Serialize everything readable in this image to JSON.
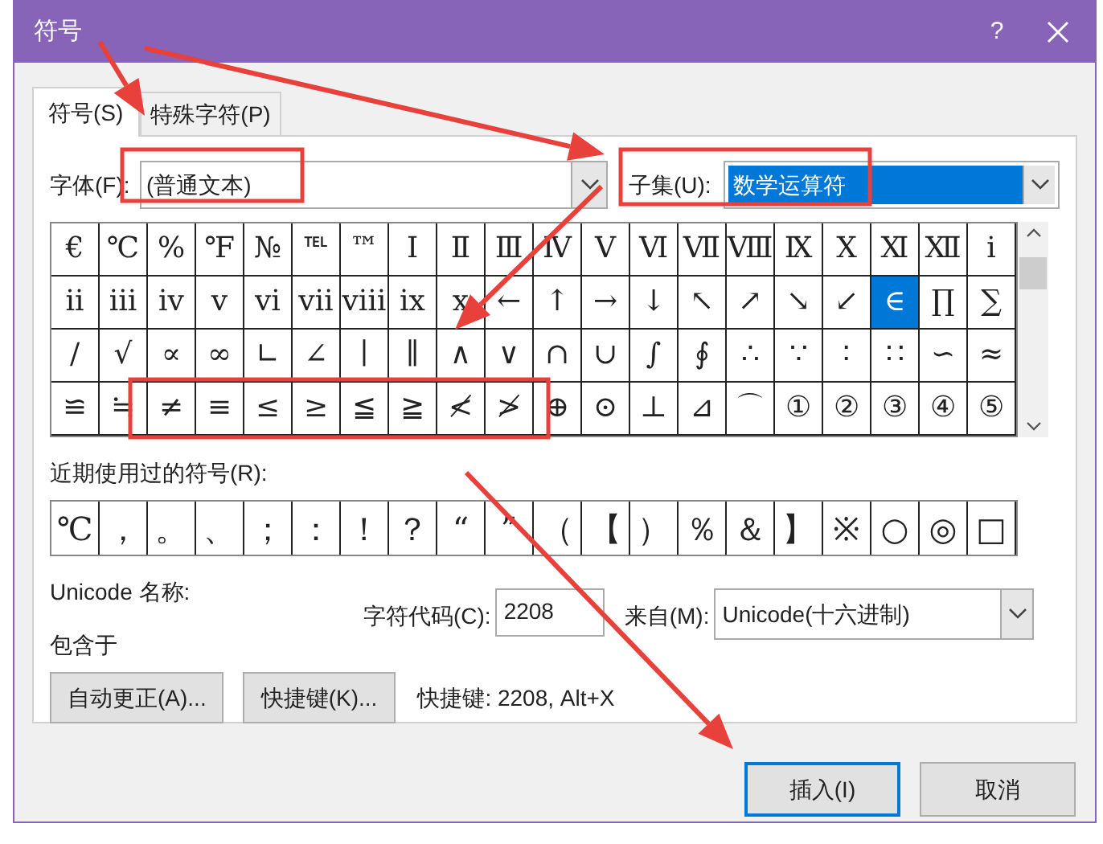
{
  "window": {
    "title": "符号",
    "help": "?"
  },
  "tabs": [
    {
      "label": "符号(S)",
      "selected": true
    },
    {
      "label": "特殊字符(P)",
      "selected": false
    }
  ],
  "font": {
    "label": "字体(F):",
    "value": "(普通文本)"
  },
  "subset": {
    "label": "子集(U):",
    "value": "数学运算符"
  },
  "symbols": [
    [
      {
        "char": "€",
        "selected": false
      },
      {
        "char": "℃",
        "selected": false
      },
      {
        "char": "%",
        "selected": false
      },
      {
        "char": "℉",
        "selected": false
      },
      {
        "char": "№",
        "selected": false
      },
      {
        "char": "℡",
        "selected": false
      },
      {
        "char": "™",
        "selected": false
      },
      {
        "char": "Ⅰ",
        "selected": false
      },
      {
        "char": "Ⅱ",
        "selected": false
      },
      {
        "char": "Ⅲ",
        "selected": false
      },
      {
        "char": "Ⅳ",
        "selected": false
      },
      {
        "char": "Ⅴ",
        "selected": false
      },
      {
        "char": "Ⅵ",
        "selected": false
      },
      {
        "char": "Ⅶ",
        "selected": false
      },
      {
        "char": "Ⅷ",
        "selected": false
      },
      {
        "char": "Ⅸ",
        "selected": false
      },
      {
        "char": "Ⅹ",
        "selected": false
      },
      {
        "char": "Ⅺ",
        "selected": false
      },
      {
        "char": "Ⅻ",
        "selected": false
      },
      {
        "char": "ⅰ",
        "selected": false
      }
    ],
    [
      {
        "char": "ⅱ",
        "selected": false
      },
      {
        "char": "ⅲ",
        "selected": false
      },
      {
        "char": "ⅳ",
        "selected": false
      },
      {
        "char": "ⅴ",
        "selected": false
      },
      {
        "char": "ⅵ",
        "selected": false
      },
      {
        "char": "ⅶ",
        "selected": false
      },
      {
        "char": "ⅷ",
        "selected": false
      },
      {
        "char": "ⅸ",
        "selected": false
      },
      {
        "char": "ⅹ",
        "selected": false
      },
      {
        "char": "←",
        "selected": false
      },
      {
        "char": "↑",
        "selected": false
      },
      {
        "char": "→",
        "selected": false
      },
      {
        "char": "↓",
        "selected": false
      },
      {
        "char": "↖",
        "selected": false
      },
      {
        "char": "↗",
        "selected": false
      },
      {
        "char": "↘",
        "selected": false
      },
      {
        "char": "↙",
        "selected": false
      },
      {
        "char": "∈",
        "selected": true
      },
      {
        "char": "∏",
        "selected": false
      },
      {
        "char": "∑",
        "selected": false
      }
    ],
    [
      {
        "char": "∕",
        "selected": false
      },
      {
        "char": "√",
        "selected": false
      },
      {
        "char": "∝",
        "selected": false
      },
      {
        "char": "∞",
        "selected": false
      },
      {
        "char": "∟",
        "selected": false
      },
      {
        "char": "∠",
        "selected": false
      },
      {
        "char": "∣",
        "selected": false
      },
      {
        "char": "∥",
        "selected": false
      },
      {
        "char": "∧",
        "selected": false
      },
      {
        "char": "∨",
        "selected": false
      },
      {
        "char": "∩",
        "selected": false
      },
      {
        "char": "∪",
        "selected": false
      },
      {
        "char": "∫",
        "selected": false
      },
      {
        "char": "∮",
        "selected": false
      },
      {
        "char": "∴",
        "selected": false
      },
      {
        "char": "∵",
        "selected": false
      },
      {
        "char": "∶",
        "selected": false
      },
      {
        "char": "∷",
        "selected": false
      },
      {
        "char": "∽",
        "selected": false
      },
      {
        "char": "≈",
        "selected": false
      }
    ],
    [
      {
        "char": "≌",
        "selected": false
      },
      {
        "char": "≒",
        "selected": false
      },
      {
        "char": "≠",
        "selected": false
      },
      {
        "char": "≡",
        "selected": false
      },
      {
        "char": "≤",
        "selected": false
      },
      {
        "char": "≥",
        "selected": false
      },
      {
        "char": "≦",
        "selected": false
      },
      {
        "char": "≧",
        "selected": false
      },
      {
        "char": "≮",
        "selected": false
      },
      {
        "char": "≯",
        "selected": false
      },
      {
        "char": "⊕",
        "selected": false
      },
      {
        "char": "⊙",
        "selected": false
      },
      {
        "char": "⊥",
        "selected": false
      },
      {
        "char": "⊿",
        "selected": false
      },
      {
        "char": "⌒",
        "selected": false
      },
      {
        "char": "①",
        "selected": false
      },
      {
        "char": "②",
        "selected": false
      },
      {
        "char": "③",
        "selected": false
      },
      {
        "char": "④",
        "selected": false
      },
      {
        "char": "⑤",
        "selected": false
      }
    ]
  ],
  "recent": {
    "label": "近期使用过的符号(R):",
    "symbols": [
      "℃",
      "，",
      "。",
      "、",
      "；",
      "：",
      "！",
      "？",
      "“",
      "”",
      "（",
      "【",
      "）",
      "％",
      "＆",
      "】",
      "※",
      "○",
      "◎",
      "□"
    ]
  },
  "unicode_name": {
    "label": "Unicode 名称:",
    "value": "包含于"
  },
  "char_code": {
    "label": "字符代码(C):",
    "value": "2208"
  },
  "from": {
    "label": "来自(M):",
    "value": "Unicode(十六进制)"
  },
  "buttons": [
    "自动更正(A)...",
    "快捷键(K)..."
  ],
  "shortcut": "快捷键: 2208, Alt+X",
  "footer_buttons": [
    {
      "label": "插入(I)",
      "default": true
    },
    {
      "label": "取消",
      "default": false
    }
  ]
}
